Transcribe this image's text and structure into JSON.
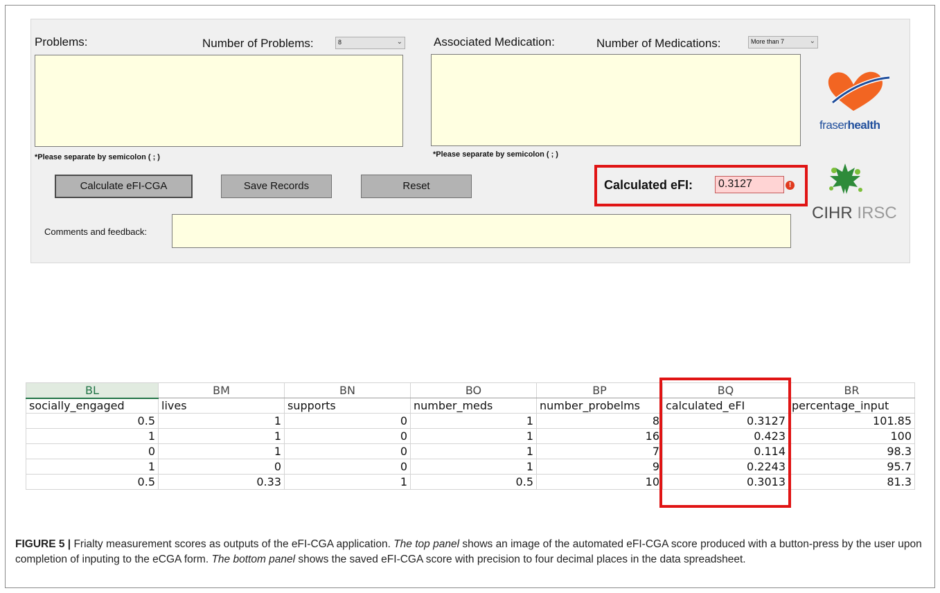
{
  "app": {
    "problems_label": "Problems:",
    "num_problems_label": "Number of Problems:",
    "num_problems_value": "8",
    "medication_label": "Associated Medication:",
    "num_medications_label": "Number of Medications:",
    "num_medications_value": "More than 7",
    "problems_hint": "*Please separate by semicolon ( ; )",
    "medication_hint": "*Please separate by semicolon ( ; )",
    "buttons": {
      "calculate": "Calculate eFI-CGA",
      "save": "Save Records",
      "reset": "Reset"
    },
    "calculated_efi_label": "Calculated eFI:",
    "calculated_efi_value": "0.3127",
    "comments_label": "Comments and feedback:",
    "logo_fraser": "fraserhealth",
    "logo_cihr": "CIHR IRSC"
  },
  "spreadsheet": {
    "column_letters": [
      "BL",
      "BM",
      "BN",
      "BO",
      "BP",
      "BQ",
      "BR"
    ],
    "headers": [
      "socially_engaged",
      "lives",
      "supports",
      "number_meds",
      "number_probelms",
      "calculated_eFI",
      "percentage_input"
    ],
    "rows": [
      [
        "0.5",
        "1",
        "0",
        "1",
        "8",
        "0.3127",
        "101.85"
      ],
      [
        "1",
        "1",
        "0",
        "1",
        "16",
        "0.423",
        "100"
      ],
      [
        "0",
        "1",
        "0",
        "1",
        "7",
        "0.114",
        "98.3"
      ],
      [
        "1",
        "0",
        "0",
        "1",
        "9",
        "0.2243",
        "95.7"
      ],
      [
        "0.5",
        "0.33",
        "1",
        "0.5",
        "10",
        "0.3013",
        "81.3"
      ]
    ]
  },
  "caption": {
    "figure_label": "FIGURE 5 |",
    "text1": " Frialty measurement scores as outputs of the eFI-CGA application. ",
    "italic1": "The top panel",
    "text2": " shows an image of the automated eFI-CGA score produced with a button-press by the user upon completion of inputing to the eCGA form. ",
    "italic2": "The bottom panel",
    "text3": " shows the saved eFI-CGA score with precision to four decimal places in the data spreadsheet."
  }
}
